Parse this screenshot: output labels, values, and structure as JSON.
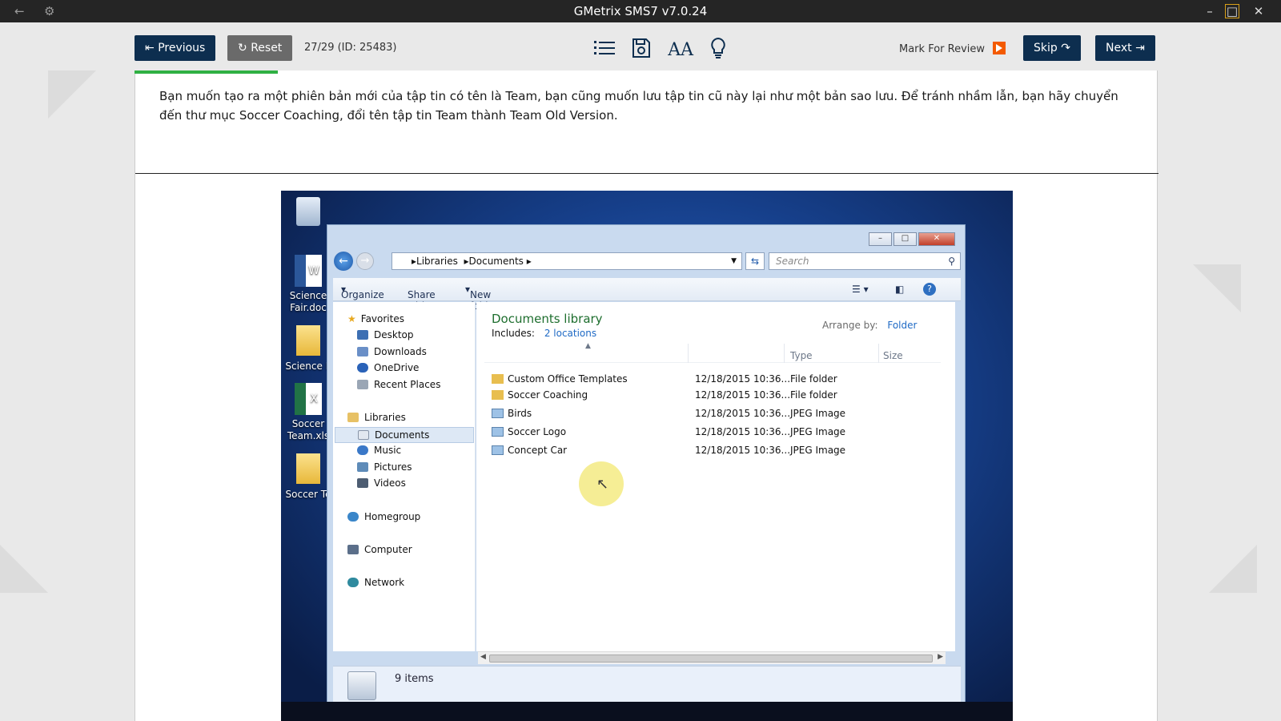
{
  "window": {
    "title": "GMetrix SMS7 v7.0.24",
    "back_icon": "arrow-left-icon",
    "settings_icon": "gear-icon"
  },
  "toolbar": {
    "previous_label": "Previous",
    "reset_label": "Reset",
    "question_counter": "27/29 (ID: 25483)",
    "mark_for_review_label": "Mark For Review",
    "skip_label": "Skip",
    "next_label": "Next",
    "icons": [
      "list-icon",
      "save-icon",
      "font-size-icon",
      "lightbulb-icon"
    ]
  },
  "question": {
    "text": "Bạn muốn tạo ra một phiên bản mới của tập tin có tên là Team, bạn cũng muốn lưu tập tin cũ này lại như một bản sao lưu. Để tránh nhầm lẫn, bạn hãy chuyển đến thư mục Soccer Coaching, đổi tên tập tin Team thành Team Old Version.",
    "progress_fraction": 0.14
  },
  "desktop": {
    "icons": [
      {
        "label": "Science Fair.doc"
      },
      {
        "label": "Science F"
      },
      {
        "label": "Soccer Team.xls"
      },
      {
        "label": "Soccer Te"
      }
    ]
  },
  "explorer": {
    "breadcrumb": [
      "Libraries",
      "Documents"
    ],
    "search_placeholder": "Search",
    "commands": {
      "organize": "Organize",
      "share_with": "Share with",
      "new_folder": "New folder"
    },
    "nav": {
      "favorites": "Favorites",
      "favorites_items": [
        "Desktop",
        "Downloads",
        "OneDrive",
        "Recent Places"
      ],
      "libraries": "Libraries",
      "libraries_items": [
        "Documents",
        "Music",
        "Pictures",
        "Videos"
      ],
      "homegroup": "Homegroup",
      "computer": "Computer",
      "network": "Network"
    },
    "library": {
      "title": "Documents library",
      "includes_label": "Includes:",
      "includes_link": "2 locations",
      "arrange_by_label": "Arrange by:",
      "arrange_by_value": "Folder"
    },
    "columns": {
      "type": "Type",
      "size": "Size"
    },
    "files": [
      {
        "name": "Custom Office Templates",
        "date": "12/18/2015 10:36...",
        "type": "File folder"
      },
      {
        "name": "Soccer Coaching",
        "date": "12/18/2015 10:36...",
        "type": "File folder"
      },
      {
        "name": "Birds",
        "date": "12/18/2015 10:36...",
        "type": "JPEG Image"
      },
      {
        "name": "Soccer Logo",
        "date": "12/18/2015 10:36...",
        "type": "JPEG Image"
      },
      {
        "name": "Concept Car",
        "date": "12/18/2015 10:36...",
        "type": "JPEG Image"
      }
    ],
    "status": "9 items"
  },
  "colors": {
    "accent_dark": "#0d2e4f",
    "progress": "#2fb043",
    "flag": "#f35a00",
    "link_blue": "#1f6ac5",
    "library_title": "#1e6e2e"
  }
}
